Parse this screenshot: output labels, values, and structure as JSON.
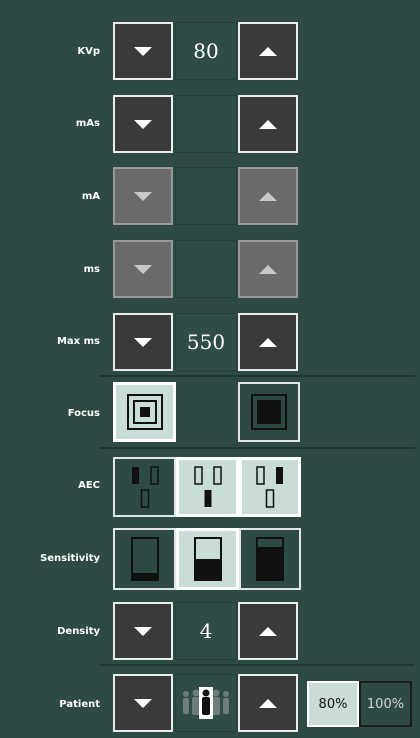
{
  "rows": {
    "kvp": {
      "label": "KVp",
      "value": "80"
    },
    "mas": {
      "label": "mAs",
      "value": ""
    },
    "ma": {
      "label": "mA",
      "value": ""
    },
    "ms": {
      "label": "ms",
      "value": ""
    },
    "max_ms": {
      "label": "Max ms",
      "value": "550"
    },
    "focus": {
      "label": "Focus",
      "options": [
        "small-focus-icon",
        "large-focus-icon"
      ],
      "selected": 0
    },
    "aec": {
      "label": "AEC",
      "options": [
        "aec-left-chambers-icon",
        "aec-center-chamber-icon",
        "aec-right-chamber-icon"
      ],
      "selected": [
        1,
        2
      ]
    },
    "sensitivity": {
      "label": "Sensitivity",
      "options": [
        "sensitivity-low-icon",
        "sensitivity-medium-icon",
        "sensitivity-high-icon"
      ],
      "selected": 1
    },
    "density": {
      "label": "Density",
      "value": "4"
    },
    "patient": {
      "label": "Patient",
      "icon": "patient-size-icon",
      "percent_80": "80%",
      "percent_100": "100%",
      "selected_percent": "80%"
    }
  },
  "colors": {
    "background": "#2d4a44",
    "selected": "#c9dcd8",
    "button": "#3a3a3a",
    "button_disabled": "#6a6a6a"
  }
}
